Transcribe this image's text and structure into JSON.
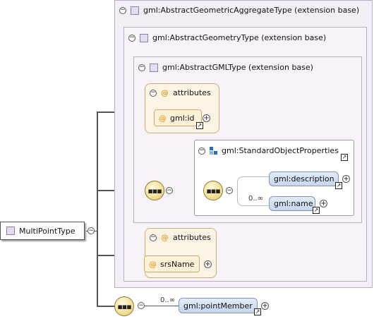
{
  "root": {
    "label": "MultiPointType"
  },
  "ext1": {
    "label": "gml:AbstractGeometricAggregateType (extension base)"
  },
  "ext2": {
    "label": "gml:AbstractGeometryType (extension base)"
  },
  "ext3": {
    "label": "gml:AbstractGMLType (extension base)"
  },
  "attrs1": {
    "label": "attributes",
    "item": "gml:id"
  },
  "group": {
    "label": "gml:StandardObjectProperties",
    "cardinality": "0..∞",
    "items": [
      {
        "label": "gml:description"
      },
      {
        "label": "gml:name"
      }
    ]
  },
  "attrs2": {
    "label": "attributes",
    "item": "srsName"
  },
  "member": {
    "label": "gml:pointMember",
    "cardinality": "0..∞"
  },
  "icons": {
    "collapse": "minus-circle",
    "expand": "plus-circle",
    "shortcut": "arrow-link",
    "sequence": "sequence-compositor",
    "attribute": "at-sign",
    "group": "group-icon",
    "type": "type-square"
  }
}
